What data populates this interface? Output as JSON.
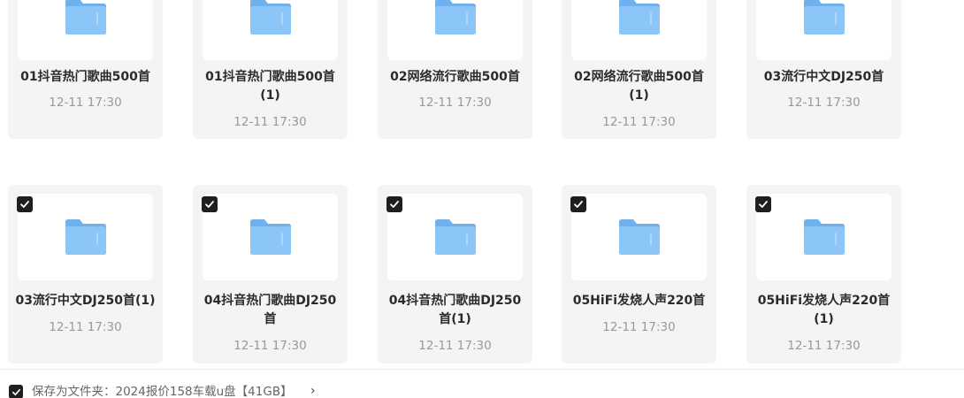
{
  "folders": [
    {
      "name_line1": "01抖音热门歌曲500首",
      "name_line2": "",
      "date": "12-11 17:30",
      "checked": false
    },
    {
      "name_line1": "01抖音热门歌曲500首",
      "name_line2": "(1)",
      "date": "12-11 17:30",
      "checked": false
    },
    {
      "name_line1": "02网络流行歌曲500首",
      "name_line2": "",
      "date": "12-11 17:30",
      "checked": false
    },
    {
      "name_line1": "02网络流行歌曲500首",
      "name_line2": "(1)",
      "date": "12-11 17:30",
      "checked": false
    },
    {
      "name_line1": "03流行中文DJ250首",
      "name_line2": "",
      "date": "12-11 17:30",
      "checked": false
    },
    {
      "name_line1": "03流行中文DJ250首(1)",
      "name_line2": "",
      "date": "12-11 17:30",
      "checked": true
    },
    {
      "name_line1": "04抖音热门歌曲DJ250",
      "name_line2": "首",
      "date": "12-11 17:30",
      "checked": true
    },
    {
      "name_line1": "04抖音热门歌曲DJ250",
      "name_line2": "首(1)",
      "date": "12-11 17:30",
      "checked": true
    },
    {
      "name_line1": "05HiFi发烧人声220首",
      "name_line2": "",
      "date": "12-11 17:30",
      "checked": true
    },
    {
      "name_line1": "05HiFi发烧人声220首",
      "name_line2": "(1)",
      "date": "12-11 17:30",
      "checked": true
    }
  ],
  "footer": {
    "save_label": "保存为文件夹：2024报价158车载u盘【41GB】",
    "chevron": "›",
    "checked": true
  },
  "icons": {
    "folder": "folder-icon",
    "check": "checkmark-icon",
    "chevron": "chevron-right-icon"
  },
  "colors": {
    "folder_body": "#8cc5f7",
    "folder_tab": "#6fb1ef",
    "card_bg": "#f4f4f5",
    "check_bg": "#1f1f1f"
  }
}
